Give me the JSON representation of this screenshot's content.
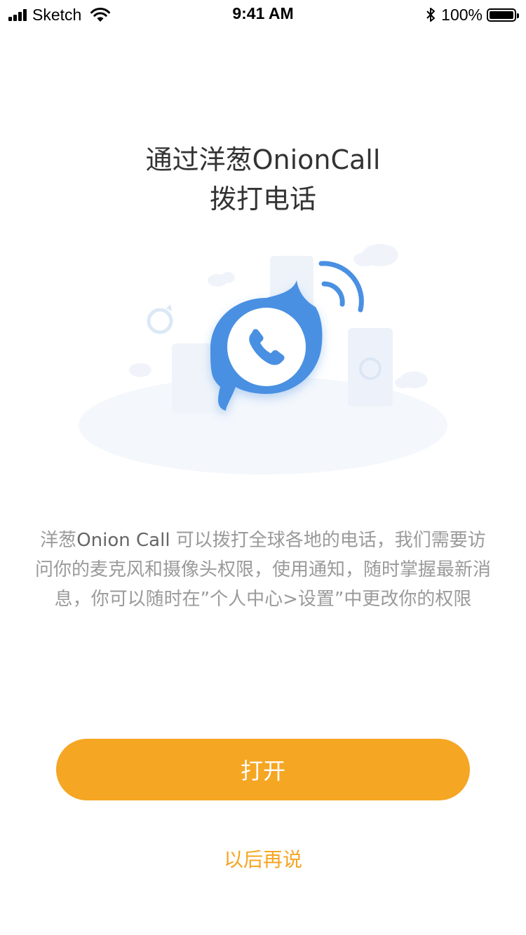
{
  "status_bar": {
    "carrier": "Sketch",
    "time": "9:41 AM",
    "battery_percent": "100%",
    "icons": [
      "signal-icon",
      "wifi-icon",
      "bluetooth-icon",
      "battery-icon"
    ]
  },
  "title": {
    "line1": "通过洋葱OnionCall",
    "line2": "拨打电话"
  },
  "illustration": {
    "icons": [
      "phone-bubble-icon",
      "signal-waves-icon",
      "phone-card-icon",
      "cloud-icon"
    ]
  },
  "description": {
    "prefix": "洋葱",
    "brand": "Onion Call",
    "text": " 可以拨打全球各地的电话，我们需要访问你的麦克风和摄像头权限，使用通知，随时掌握最新消息，你可以随时在”个人中心>设置”中更改你的权限"
  },
  "buttons": {
    "open_label": "打开",
    "later_label": "以后再说"
  },
  "colors": {
    "accent": "#F5A623",
    "primary_blue": "#4A90E2",
    "text_dark": "#333333",
    "text_gray": "#9A9A9A"
  }
}
